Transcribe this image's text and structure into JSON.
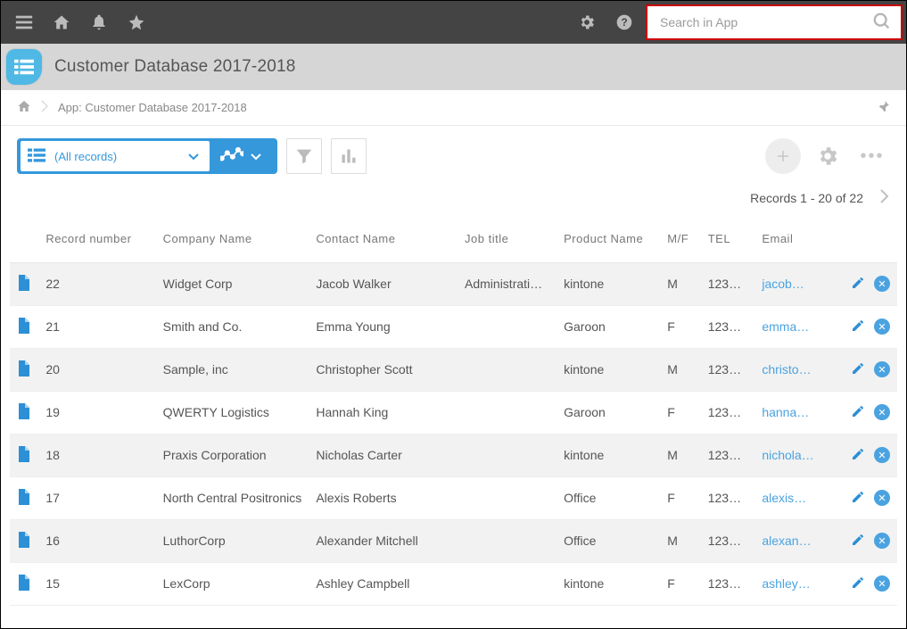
{
  "topbar": {
    "search_placeholder": "Search in App"
  },
  "title": "Customer Database 2017-2018",
  "breadcrumb": {
    "label": "App: Customer Database 2017-2018"
  },
  "toolbar": {
    "view_label": "(All records)"
  },
  "records_count": "Records 1 - 20 of 22",
  "columns": {
    "record_number": "Record number",
    "company": "Company Name",
    "contact": "Contact Name",
    "job": "Job title",
    "product": "Product Name",
    "mf": "M/F",
    "tel": "TEL",
    "email": "Email"
  },
  "rows": [
    {
      "recno": "22",
      "company": "Widget Corp",
      "contact": "Jacob Walker",
      "job": "Administrati…",
      "product": "kintone",
      "mf": "M",
      "tel": "123…",
      "email": "jacob…"
    },
    {
      "recno": "21",
      "company": "Smith and Co.",
      "contact": "Emma Young",
      "job": "",
      "product": "Garoon",
      "mf": "F",
      "tel": "123…",
      "email": "emma…"
    },
    {
      "recno": "20",
      "company": "Sample, inc",
      "contact": "Christopher Scott",
      "job": "",
      "product": "kintone",
      "mf": "M",
      "tel": "123…",
      "email": "christo…"
    },
    {
      "recno": "19",
      "company": "QWERTY Logistics",
      "contact": "Hannah King",
      "job": "",
      "product": "Garoon",
      "mf": "F",
      "tel": "123…",
      "email": "hanna…"
    },
    {
      "recno": "18",
      "company": "Praxis Corporation",
      "contact": "Nicholas Carter",
      "job": "",
      "product": "kintone",
      "mf": "M",
      "tel": "123…",
      "email": "nichola…"
    },
    {
      "recno": "17",
      "company": "North Central Positronics",
      "contact": "Alexis Roberts",
      "job": "",
      "product": "Office",
      "mf": "F",
      "tel": "123…",
      "email": "alexis…"
    },
    {
      "recno": "16",
      "company": "LuthorCorp",
      "contact": "Alexander Mitchell",
      "job": "",
      "product": "Office",
      "mf": "M",
      "tel": "123…",
      "email": "alexan…"
    },
    {
      "recno": "15",
      "company": "LexCorp",
      "contact": "Ashley Campbell",
      "job": "",
      "product": "kintone",
      "mf": "F",
      "tel": "123…",
      "email": "ashley…"
    }
  ]
}
